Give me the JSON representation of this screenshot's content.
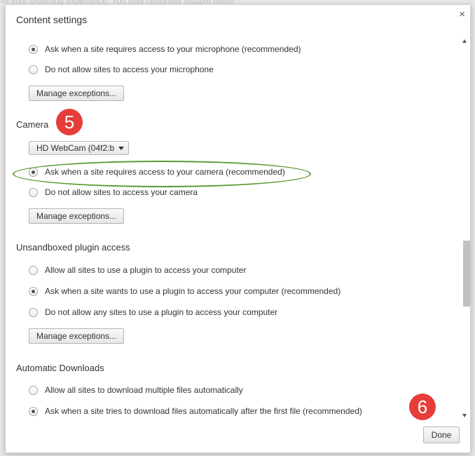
{
  "background_text": "ve your browsing experience. You may optionally disable these",
  "dialog": {
    "title": "Content settings",
    "close_label": "×",
    "done_label": "Done"
  },
  "microphone": {
    "options": [
      {
        "label": "Ask when a site requires access to your microphone (recommended)",
        "checked": true
      },
      {
        "label": "Do not allow sites to access your microphone",
        "checked": false
      }
    ],
    "manage_label": "Manage exceptions..."
  },
  "camera": {
    "heading": "Camera",
    "device": "HD WebCam (04f2:b",
    "options": [
      {
        "label": "Ask when a site requires access to your camera (recommended)",
        "checked": true
      },
      {
        "label": "Do not allow sites to access your camera",
        "checked": false
      }
    ],
    "manage_label": "Manage exceptions..."
  },
  "plugins": {
    "heading": "Unsandboxed plugin access",
    "options": [
      {
        "label": "Allow all sites to use a plugin to access your computer",
        "checked": false
      },
      {
        "label": "Ask when a site wants to use a plugin to access your computer (recommended)",
        "checked": true
      },
      {
        "label": "Do not allow any sites to use a plugin to access your computer",
        "checked": false
      }
    ],
    "manage_label": "Manage exceptions..."
  },
  "downloads": {
    "heading": "Automatic Downloads",
    "options": [
      {
        "label": "Allow all sites to download multiple files automatically",
        "checked": false
      },
      {
        "label": "Ask when a site tries to download files automatically after the first file (recommended)",
        "checked": true
      }
    ]
  },
  "annotations": {
    "step5": "5",
    "step6": "6",
    "badge_color": "#e63d3a",
    "highlight_color": "#5a9a33"
  }
}
